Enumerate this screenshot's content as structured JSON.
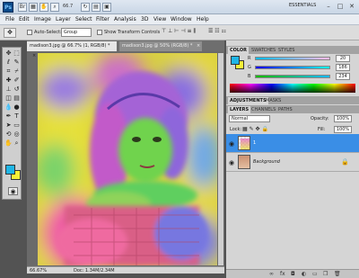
{
  "titlebar": {
    "app_logo": "Ps",
    "zoom": "66.7",
    "workspace": "ESSENTIALS",
    "icons": [
      "bridge-icon",
      "minibridge-icon",
      "hand-icon",
      "zoom-icon",
      "rotate-icon",
      "arrange-icon",
      "screenmode-icon"
    ],
    "window_controls": [
      "–",
      "□",
      "✕"
    ]
  },
  "menu": [
    "File",
    "Edit",
    "Image",
    "Layer",
    "Select",
    "Filter",
    "Analysis",
    "3D",
    "View",
    "Window",
    "Help"
  ],
  "options": {
    "auto_select_label": "Auto-Select:",
    "auto_select_value": "Group",
    "transform_label": "Show Transform Controls"
  },
  "doc": {
    "tabs": [
      {
        "label": "madison3.jpg @ 66.7% (1, RGB/8) *",
        "close": "×"
      },
      {
        "label": "madison3.jpg @ 50% (RGB/8) *",
        "close": "×"
      }
    ],
    "status": {
      "zoom": "66.67%",
      "doc_info": "Doc: 1.34M/2.34M"
    }
  },
  "color_panel": {
    "tabs": [
      "COLOR",
      "SWATCHES",
      "STYLES"
    ],
    "channels": [
      {
        "label": "R",
        "value": "20"
      },
      {
        "label": "G",
        "value": "186"
      },
      {
        "label": "B",
        "value": "234"
      }
    ]
  },
  "adjust_panel": {
    "tabs": [
      "ADJUSTMENTS",
      "MASKS"
    ]
  },
  "layers_panel": {
    "tabs": [
      "LAYERS",
      "CHANNELS",
      "PATHS"
    ],
    "blend_mode": "Normal",
    "opacity_label": "Opacity:",
    "opacity_value": "100%",
    "lock_label": "Lock:",
    "fill_label": "Fill:",
    "fill_value": "100%",
    "layers": [
      {
        "name": "1",
        "selected": true
      },
      {
        "name": "Background",
        "selected": false
      }
    ]
  },
  "colors": {
    "foreground": "#1fb5e6",
    "background": "#f7ef37",
    "selection": "#3a8ee6"
  }
}
